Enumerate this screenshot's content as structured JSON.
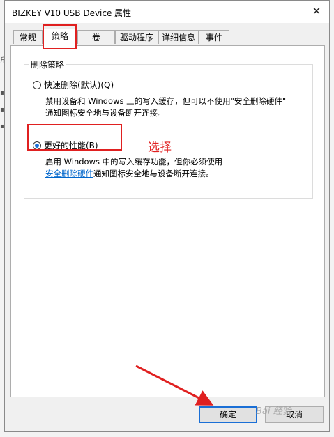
{
  "window": {
    "title": "BIZKEY V10 USB Device 属性",
    "close_symbol": "✕"
  },
  "tabs": [
    {
      "label": "常规"
    },
    {
      "label": "策略"
    },
    {
      "label": "卷"
    },
    {
      "label": "驱动程序"
    },
    {
      "label": "详细信息"
    },
    {
      "label": "事件"
    }
  ],
  "active_tab": "策略",
  "removal_policy": {
    "group_title": "删除策略",
    "quick_removal": {
      "label": "快速删除(默认)(Q)",
      "selected": false,
      "desc_line1": "禁用设备和 Windows 上的写入缓存，但可以不使用\"安全删除硬件\"",
      "desc_line2": "通知图标安全地与设备断开连接。"
    },
    "better_performance": {
      "label": "更好的性能(B)",
      "selected": true,
      "desc_line1": "启用 Windows 中的写入缓存功能，但你必须使用",
      "link_text": "安全删除硬件",
      "desc_line2_rest": "通知图标安全地与设备断开连接。"
    }
  },
  "annotation": {
    "text": "选择",
    "color": "#e02020"
  },
  "buttons": {
    "ok": "确定",
    "cancel": "取消"
  },
  "watermark": "Bai 经验",
  "colors": {
    "accent": "#1a6fd6",
    "annotation_red": "#e02020",
    "link": "#0066cc"
  }
}
